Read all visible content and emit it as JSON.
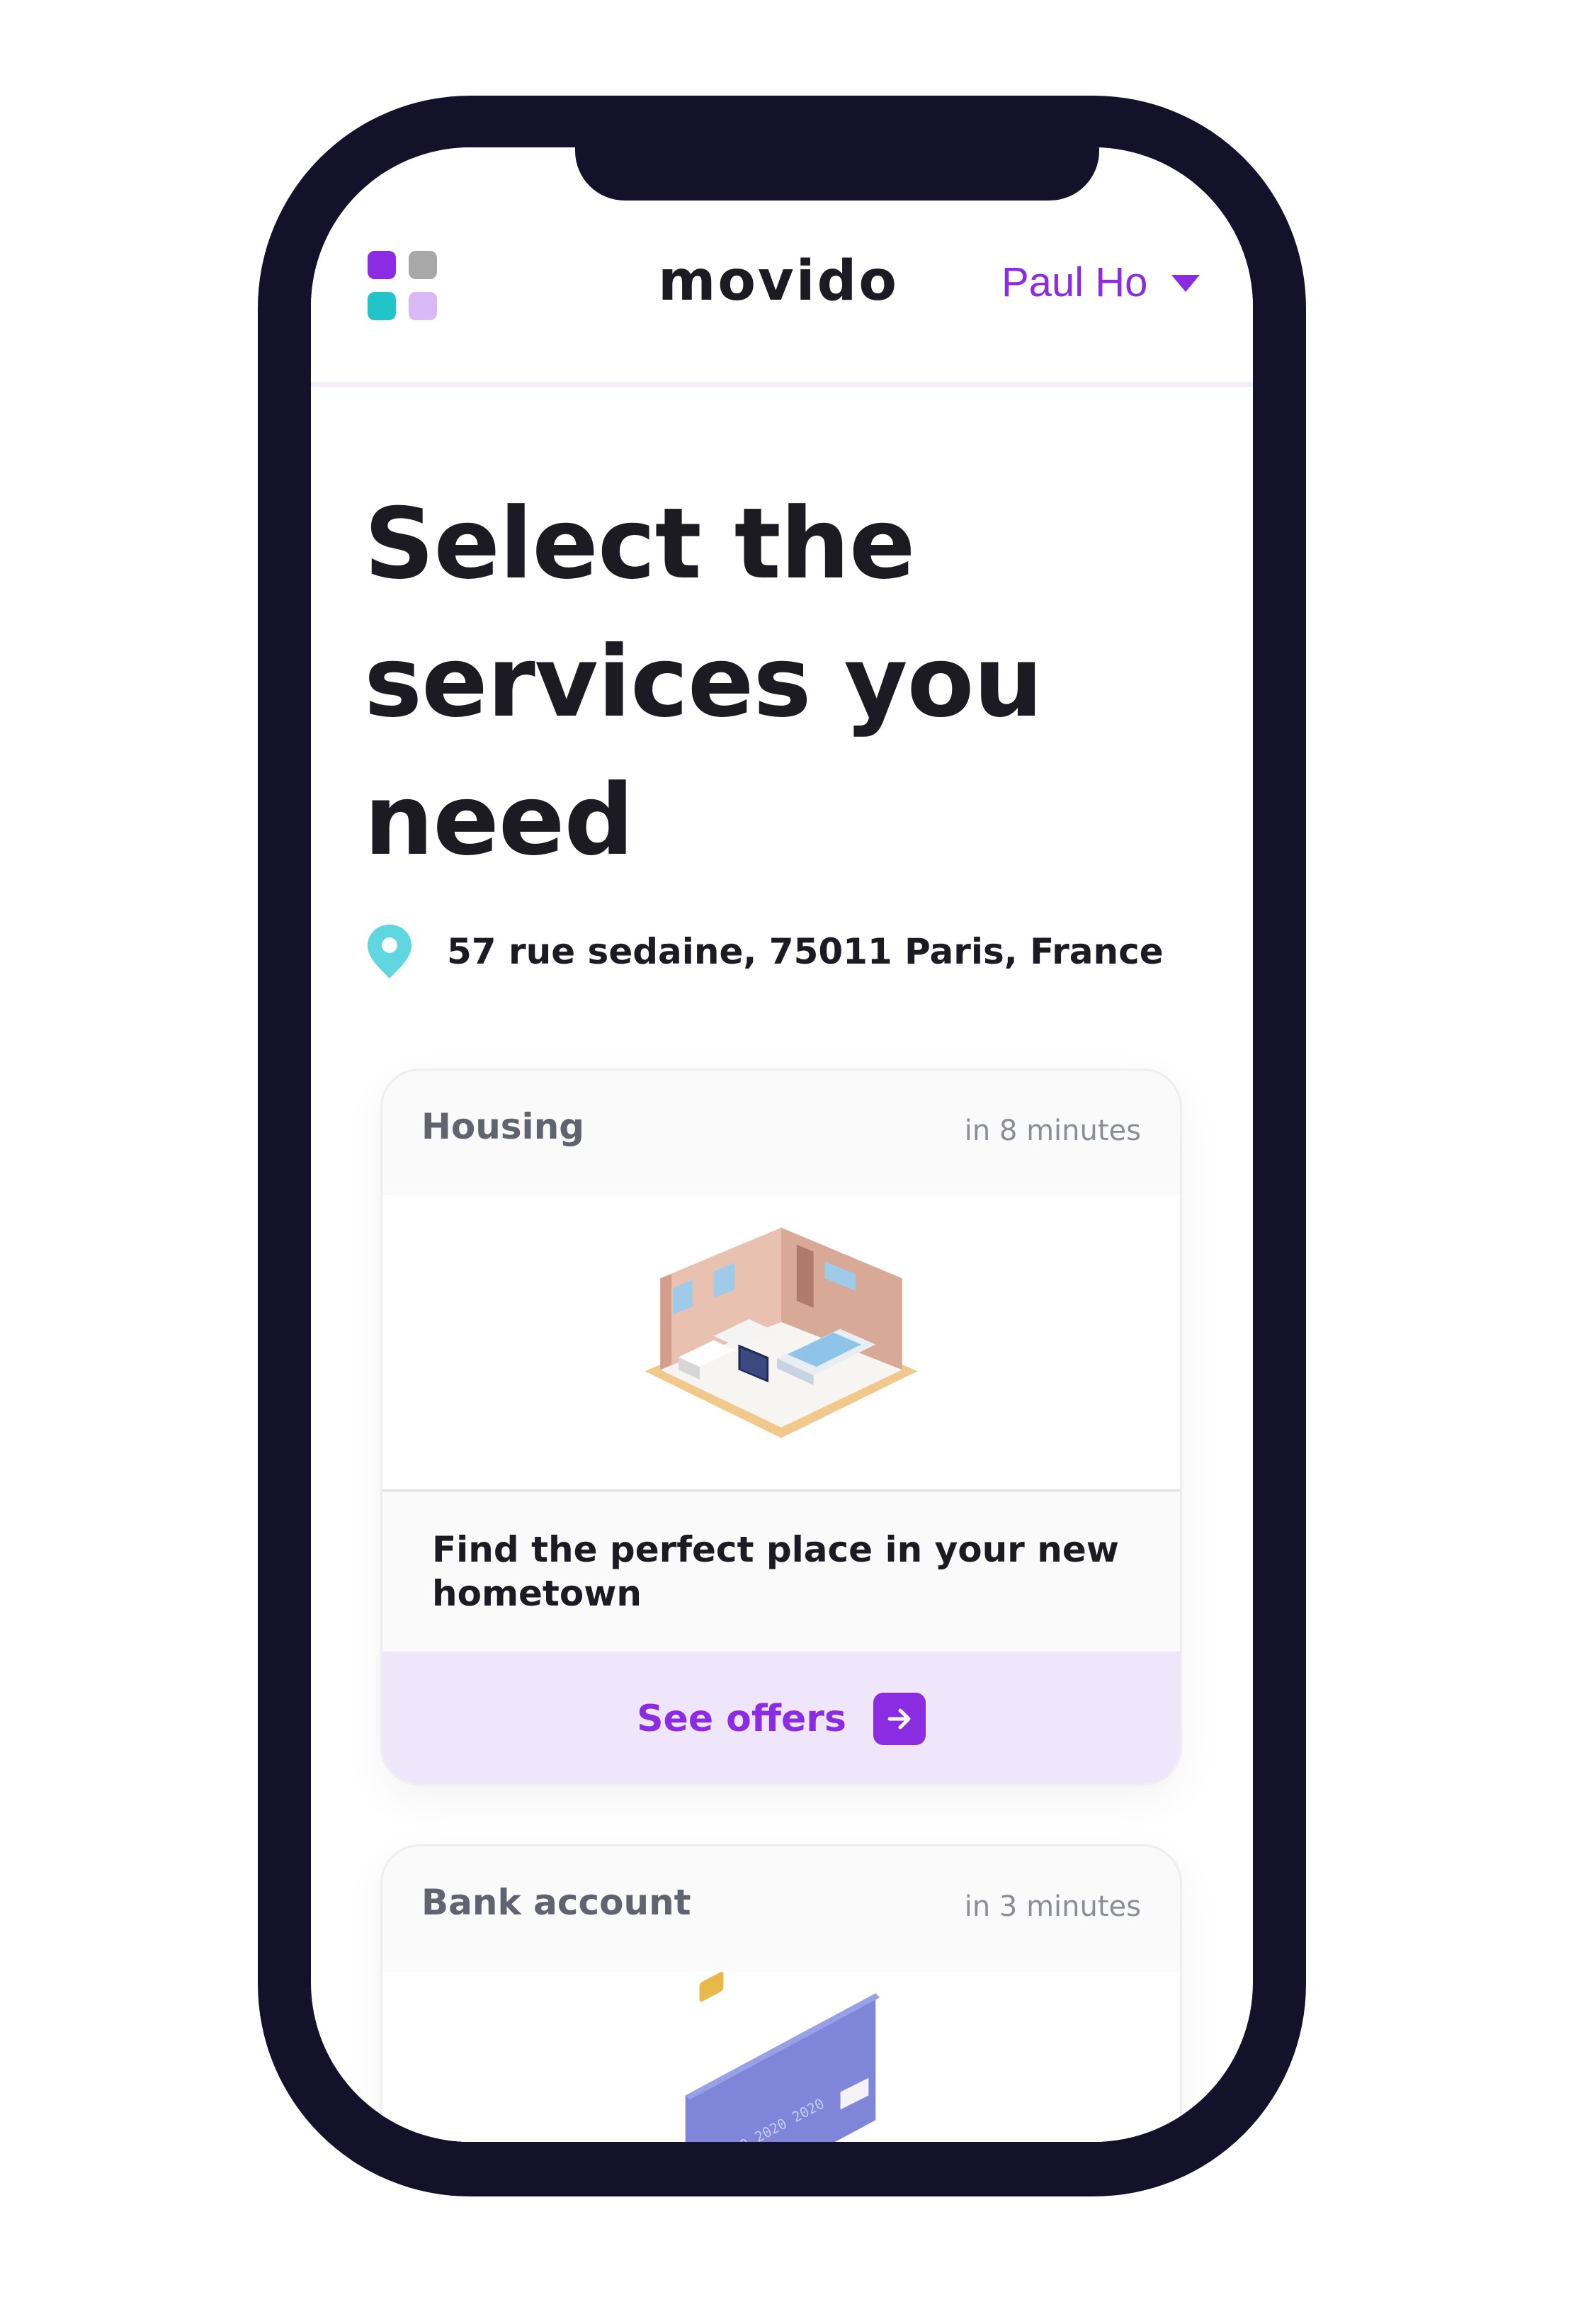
{
  "header": {
    "brand": "movido",
    "user_name": "Paul Ho",
    "logo_colors": [
      "#8b2be2",
      "#a8a8a8",
      "#20c4c9",
      "#d9b8f7"
    ]
  },
  "main": {
    "title": "Select the services you need",
    "address": "57 rue sedaine, 75011 Paris, France"
  },
  "services": [
    {
      "title": "Housing",
      "time": "in 8 minutes",
      "image": "isometric-bedroom-illustration",
      "description": "Find the perfect place in your new hometown",
      "cta": "See offers"
    },
    {
      "title": "Bank account",
      "time": "in 3 minutes",
      "image": "bank-card-illustration"
    }
  ],
  "colors": {
    "accent": "#8b2be2",
    "cta_background": "#efe6fb",
    "pin": "#5fd6e0",
    "phone_frame": "#14112a",
    "text": "#1c1b24"
  }
}
